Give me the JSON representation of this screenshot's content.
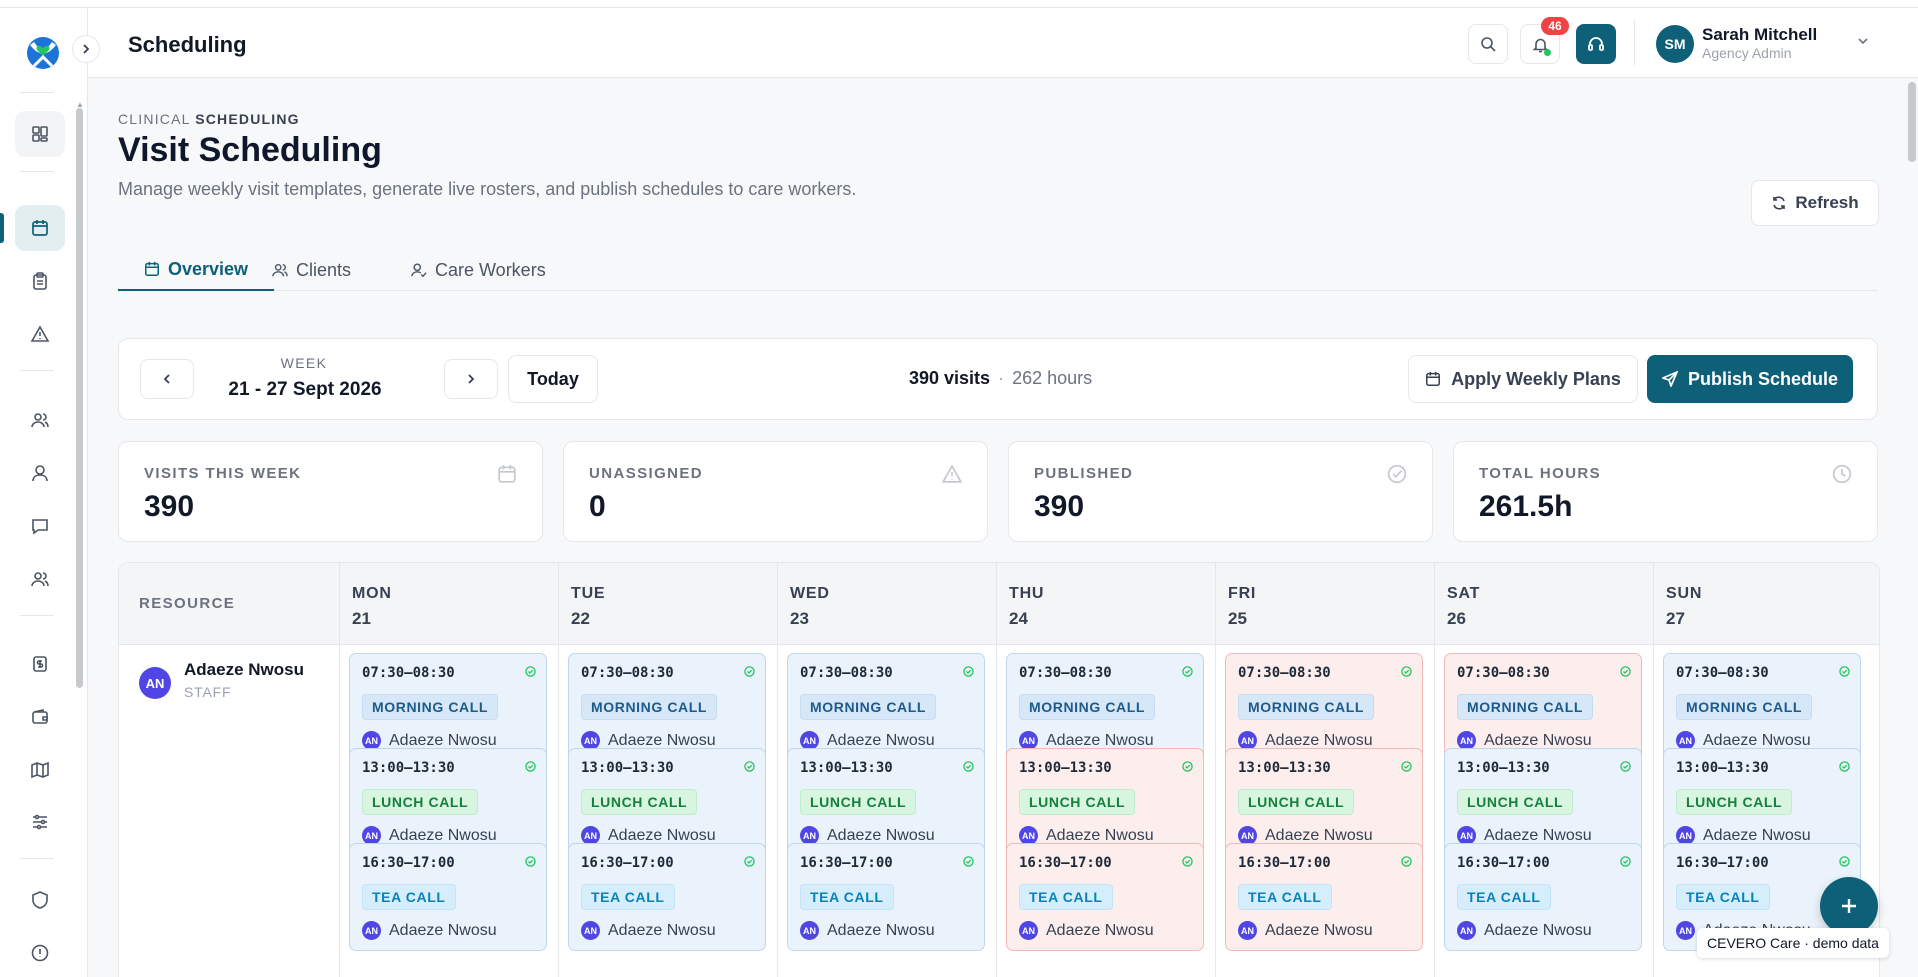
{
  "header": {
    "page_name": "Scheduling",
    "notification_count": "46",
    "user": {
      "initials": "SM",
      "name": "Sarah Mitchell",
      "role": "Agency Admin"
    }
  },
  "sidebar": {
    "items": [
      {
        "icon": "dashboard-icon"
      },
      {
        "icon": "calendar-icon",
        "active": true
      },
      {
        "icon": "clipboard-icon"
      },
      {
        "icon": "warning-icon"
      },
      {
        "icon": "users-icon"
      },
      {
        "icon": "user-icon"
      },
      {
        "icon": "message-icon"
      },
      {
        "icon": "team-icon"
      },
      {
        "icon": "billing-icon"
      },
      {
        "icon": "wallet-icon"
      },
      {
        "icon": "map-icon"
      },
      {
        "icon": "sliders-icon"
      },
      {
        "icon": "shield-icon"
      },
      {
        "icon": "info-icon"
      }
    ]
  },
  "page": {
    "eyebrow_light": "CLINICAL",
    "eyebrow_bold": "SCHEDULING",
    "title": "Visit Scheduling",
    "subtitle": "Manage weekly visit templates, generate live rosters, and publish schedules to care workers.",
    "refresh_label": "Refresh"
  },
  "tabs": [
    {
      "label": "Overview",
      "active": true
    },
    {
      "label": "Clients",
      "active": false
    },
    {
      "label": "Care Workers",
      "active": false
    }
  ],
  "week": {
    "label": "WEEK",
    "range": "21 - 27 Sept 2026",
    "today_label": "Today",
    "visits_text": "390 visits",
    "hours_text": "262 hours",
    "apply_label": "Apply Weekly Plans",
    "publish_label": "Publish Schedule"
  },
  "stats": [
    {
      "label": "VISITS THIS WEEK",
      "value": "390",
      "icon": "calendar-icon"
    },
    {
      "label": "UNASSIGNED",
      "value": "0",
      "icon": "warning-icon"
    },
    {
      "label": "PUBLISHED",
      "value": "390",
      "icon": "check-circle-icon"
    },
    {
      "label": "TOTAL HOURS",
      "value": "261.5h",
      "icon": "clock-icon"
    }
  ],
  "schedule": {
    "resource_header": "RESOURCE",
    "days": [
      {
        "name": "MON",
        "num": "21"
      },
      {
        "name": "TUE",
        "num": "22"
      },
      {
        "name": "WED",
        "num": "23"
      },
      {
        "name": "THU",
        "num": "24"
      },
      {
        "name": "FRI",
        "num": "25"
      },
      {
        "name": "SAT",
        "num": "26"
      },
      {
        "name": "SUN",
        "num": "27"
      }
    ],
    "resource": {
      "initials": "AN",
      "name": "Adaeze Nwosu",
      "role": "STAFF"
    },
    "slots": [
      {
        "time": "07:30–08:30",
        "tag": "MORNING CALL",
        "kind": "morning"
      },
      {
        "time": "13:00–13:30",
        "tag": "LUNCH CALL",
        "kind": "lunch"
      },
      {
        "time": "16:30–17:00",
        "tag": "TEA CALL",
        "kind": "tea"
      }
    ],
    "assignee": "Adaeze Nwosu",
    "assignee_initials": "AN",
    "status_colors": {
      "normal": "#eaf3fb",
      "alert": "#fdeeee"
    },
    "alert_cells": [
      [
        0,
        4
      ],
      [
        0,
        5
      ],
      [
        1,
        3
      ],
      [
        1,
        4
      ],
      [
        2,
        3
      ],
      [
        2,
        4
      ]
    ]
  },
  "demo_toast": "CEVERO Care · demo data",
  "colors": {
    "accent": "#0e6079",
    "badge": "#ef4444"
  }
}
